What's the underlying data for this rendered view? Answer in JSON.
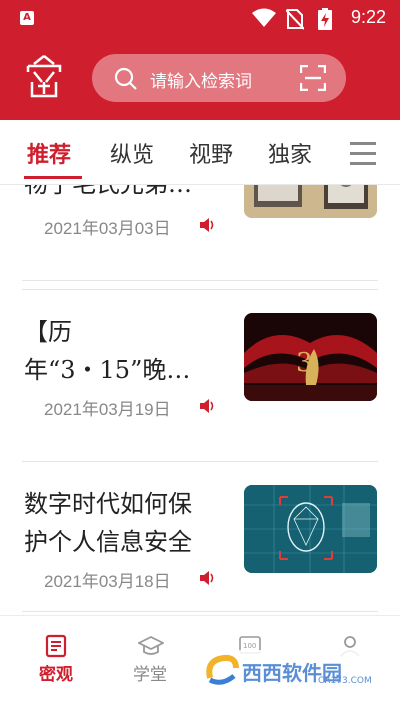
{
  "status_bar": {
    "app_badge": "A",
    "time": "9:22",
    "icons": [
      "wifi-icon",
      "no-sim-icon",
      "battery-charging-icon"
    ]
  },
  "header": {
    "logo_icon": "seal-logo-icon",
    "search_placeholder": "请输入检索词",
    "scan_icon": "scan-icon"
  },
  "tabs": [
    {
      "label": "推荐",
      "active": true
    },
    {
      "label": "纵览",
      "active": false
    },
    {
      "label": "视野",
      "active": false
    },
    {
      "label": "独家",
      "active": false
    }
  ],
  "articles": [
    {
      "title_lines": [
        "物了毛氏兄弟…"
      ],
      "date": "2021年03月03日"
    },
    {
      "title_lines": [
        "【历",
        "年“3・15”晚…"
      ],
      "date": "2021年03月19日"
    },
    {
      "title_lines": [
        "数字时代如何保",
        "护个人信息安全"
      ],
      "date": "2021年03月18日"
    }
  ],
  "bottom_nav": [
    {
      "label": "密观",
      "icon": "article-icon",
      "active": true
    },
    {
      "label": "学堂",
      "icon": "graduation-cap-icon",
      "active": false
    },
    {
      "label": "",
      "icon": "score-100-icon",
      "active": false
    },
    {
      "label": "",
      "icon": "user-icon",
      "active": false
    }
  ],
  "watermark": {
    "text": "西西软件园",
    "sub": "CR173.COM"
  },
  "colors": {
    "brand_red": "#cf1f2e",
    "search_bg": "#e37780"
  }
}
